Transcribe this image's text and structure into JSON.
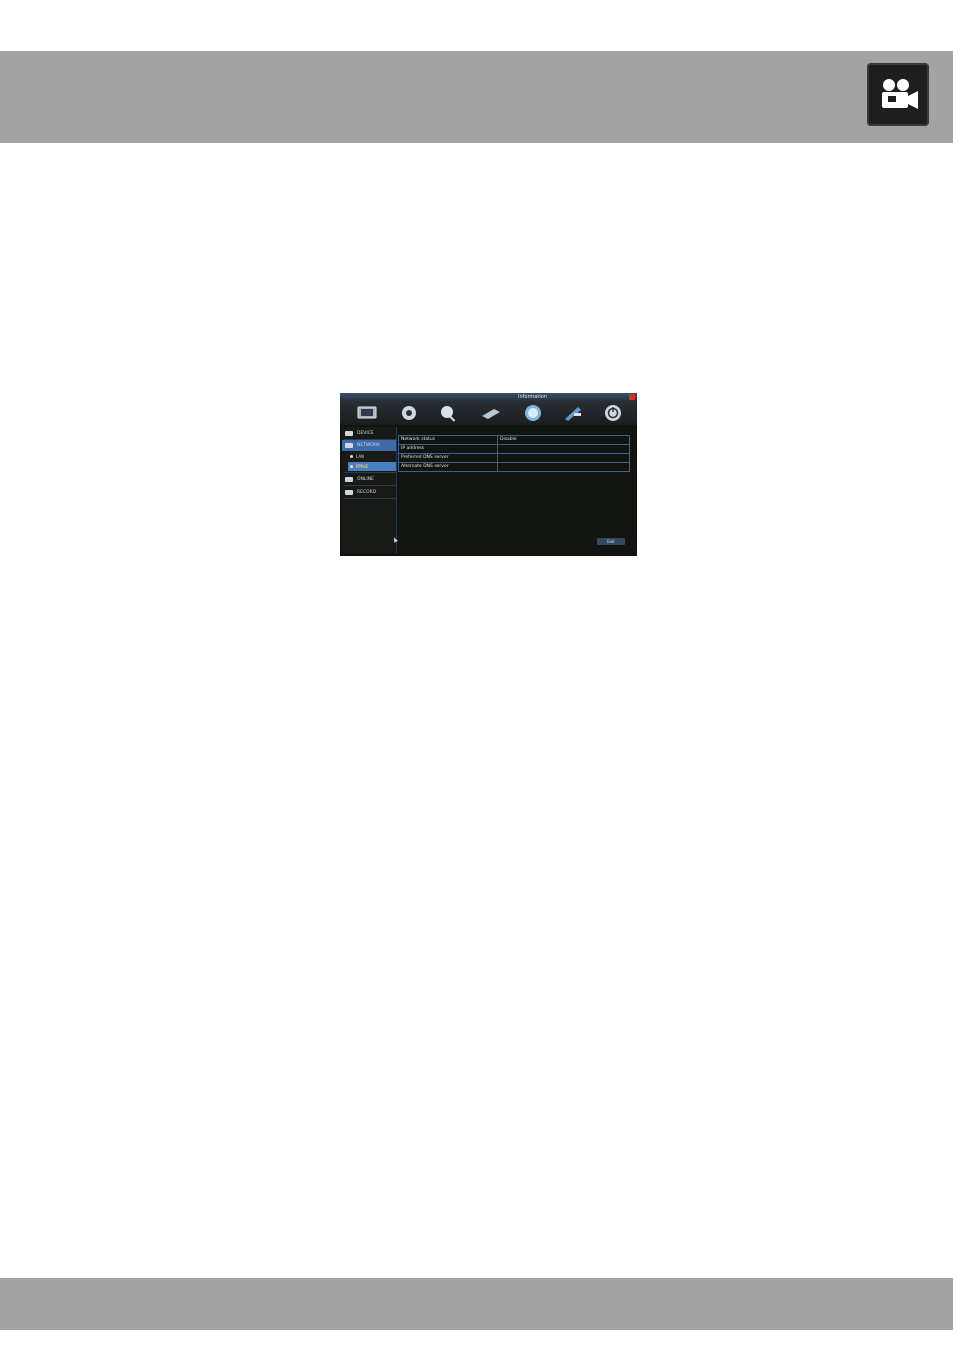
{
  "screen": {
    "title": "Information",
    "toolbar_icons": [
      "monitor-icon",
      "gear-icon",
      "search-icon",
      "hdd-icon",
      "globe-icon",
      "tools-icon",
      "power-icon"
    ],
    "sidebar": {
      "items": [
        {
          "label": "DEVICE",
          "icon": "info-icon"
        },
        {
          "label": "NETWORK",
          "icon": "network-icon"
        },
        {
          "label": "ONLINE",
          "icon": "online-icon"
        },
        {
          "label": "RECORD",
          "icon": "record-icon"
        }
      ],
      "sub_items": [
        {
          "label": "LAN"
        },
        {
          "label": "PPPoE"
        }
      ]
    },
    "table": {
      "rows": [
        {
          "label": "Network status",
          "value": "Disable"
        },
        {
          "label": "IP address",
          "value": ""
        },
        {
          "label": "Preferred DNS server",
          "value": ""
        },
        {
          "label": "Alternate DNS server",
          "value": ""
        }
      ]
    },
    "exit_label": "Exit"
  },
  "colors": {
    "bars": "#a3a3a3",
    "active_menu": "#3d6aa8",
    "table_border": "#3f6185"
  }
}
